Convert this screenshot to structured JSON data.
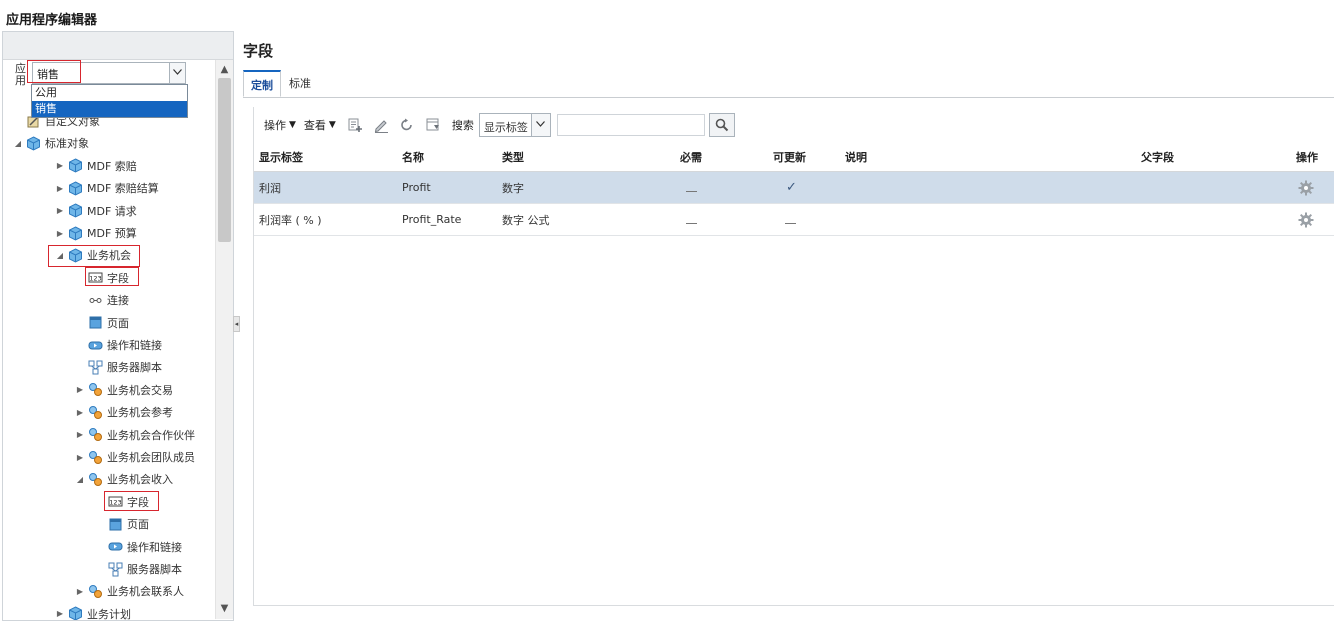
{
  "app": {
    "title": "应用程序编辑器"
  },
  "left_panel": {
    "app_label": "应用",
    "app_select_value": "销售",
    "dropdown_options": [
      "公用",
      "销售"
    ],
    "tree": [
      {
        "label": "自定义对象",
        "level": 1,
        "icon": "custom-object-icon",
        "toggle": ""
      },
      {
        "label": "标准对象",
        "level": 1,
        "icon": "cube-icon",
        "toggle": "expanded"
      },
      {
        "label": "MDF 索赔",
        "level": 2,
        "icon": "cube-icon",
        "toggle": "collapsed"
      },
      {
        "label": "MDF 索赔结算",
        "level": 2,
        "icon": "cube-icon",
        "toggle": "collapsed"
      },
      {
        "label": "MDF 请求",
        "level": 2,
        "icon": "cube-icon",
        "toggle": "collapsed"
      },
      {
        "label": "MDF 预算",
        "level": 2,
        "icon": "cube-icon",
        "toggle": "collapsed"
      },
      {
        "label": "业务机会",
        "level": 2,
        "icon": "cube-icon",
        "toggle": "expanded"
      },
      {
        "label": "字段",
        "level": 3,
        "icon": "field-icon",
        "toggle": ""
      },
      {
        "label": "连接",
        "level": 3,
        "icon": "link-icon",
        "toggle": ""
      },
      {
        "label": "页面",
        "level": 3,
        "icon": "page-icon",
        "toggle": ""
      },
      {
        "label": "操作和链接",
        "level": 3,
        "icon": "action-icon",
        "toggle": ""
      },
      {
        "label": "服务器脚本",
        "level": 3,
        "icon": "script-icon",
        "toggle": ""
      },
      {
        "label": "业务机会交易",
        "level": 3,
        "icon": "child-object-icon",
        "toggle": "collapsed"
      },
      {
        "label": "业务机会参考",
        "level": 3,
        "icon": "child-object-icon",
        "toggle": "collapsed"
      },
      {
        "label": "业务机会合作伙伴",
        "level": 3,
        "icon": "child-object-icon",
        "toggle": "collapsed"
      },
      {
        "label": "业务机会团队成员",
        "level": 3,
        "icon": "child-object-icon",
        "toggle": "collapsed"
      },
      {
        "label": "业务机会收入",
        "level": 3,
        "icon": "child-object-icon",
        "toggle": "expanded"
      },
      {
        "label": "字段",
        "level": 4,
        "icon": "field-icon",
        "toggle": ""
      },
      {
        "label": "页面",
        "level": 4,
        "icon": "page-icon",
        "toggle": ""
      },
      {
        "label": "操作和链接",
        "level": 4,
        "icon": "action-icon",
        "toggle": ""
      },
      {
        "label": "服务器脚本",
        "level": 4,
        "icon": "script-icon",
        "toggle": ""
      },
      {
        "label": "业务机会联系人",
        "level": 3,
        "icon": "child-object-icon",
        "toggle": "collapsed"
      },
      {
        "label": "业务计划",
        "level": 2,
        "icon": "cube-icon",
        "toggle": "collapsed"
      }
    ]
  },
  "main": {
    "title": "字段",
    "tabs": [
      {
        "label": "定制",
        "active": true
      },
      {
        "label": "标准",
        "active": false
      }
    ],
    "toolbar": {
      "actions_label": "操作",
      "view_label": "查看",
      "search_label": "搜索",
      "search_field_value": "显示标签",
      "search_input_value": ""
    },
    "columns": [
      "显示标签",
      "名称",
      "类型",
      "必需",
      "可更新",
      "说明",
      "父字段",
      "操作"
    ],
    "rows": [
      {
        "display_label": "利润",
        "name": "Profit",
        "type": "数字",
        "required": "no",
        "updatable": "yes",
        "description": "",
        "parent_field": "",
        "selected": true
      },
      {
        "display_label": "利润率 ( % )",
        "name": "Profit_Rate",
        "type": "数字 公式",
        "required": "no",
        "updatable": "no",
        "description": "",
        "parent_field": "",
        "selected": false
      }
    ]
  },
  "colors": {
    "accent": "#1565c0",
    "selected_row": "#cfdcea",
    "highlight_box": "#d7262e"
  }
}
